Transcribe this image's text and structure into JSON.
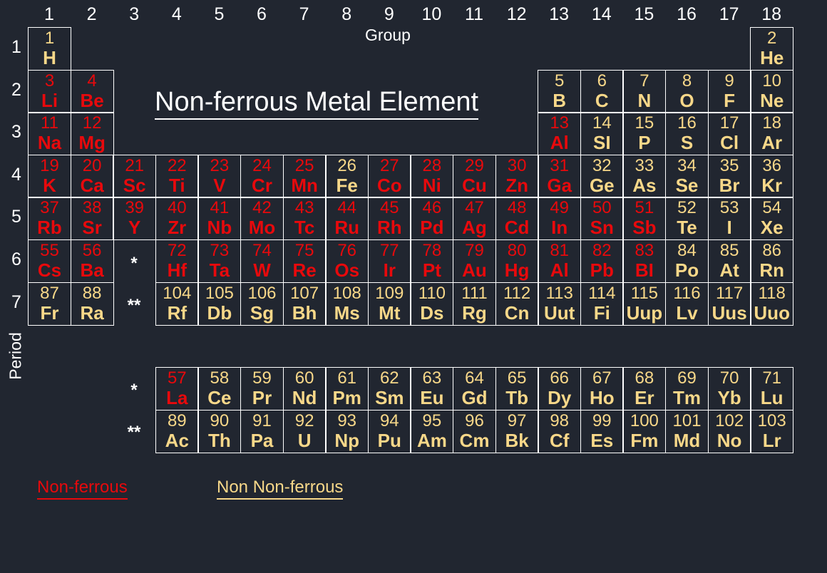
{
  "title": "Non-ferrous Metal Element",
  "axis": {
    "group_label": "Group",
    "period_label": "Period",
    "groups": [
      "1",
      "2",
      "3",
      "4",
      "5",
      "6",
      "7",
      "8",
      "9",
      "10",
      "11",
      "12",
      "13",
      "14",
      "15",
      "16",
      "17",
      "18"
    ],
    "periods": [
      "1",
      "2",
      "3",
      "4",
      "5",
      "6",
      "7"
    ]
  },
  "colors": {
    "background": "#212630",
    "non_ferrous": "#e8090c",
    "non_non_ferrous": "#f8d889",
    "grid_line": "#ffffff"
  },
  "legend": {
    "non_ferrous": "Non-ferrous",
    "non_non_ferrous": "Non Non-ferrous"
  },
  "placeholders": {
    "lanthanide_marker": "*",
    "actinide_marker": "**"
  },
  "elements": [
    {
      "n": "1",
      "s": "H",
      "g": 1,
      "p": 1,
      "nf": false
    },
    {
      "n": "2",
      "s": "He",
      "g": 18,
      "p": 1,
      "nf": false
    },
    {
      "n": "3",
      "s": "Li",
      "g": 1,
      "p": 2,
      "nf": true
    },
    {
      "n": "4",
      "s": "Be",
      "g": 2,
      "p": 2,
      "nf": true
    },
    {
      "n": "5",
      "s": "B",
      "g": 13,
      "p": 2,
      "nf": false
    },
    {
      "n": "6",
      "s": "C",
      "g": 14,
      "p": 2,
      "nf": false
    },
    {
      "n": "7",
      "s": "N",
      "g": 15,
      "p": 2,
      "nf": false
    },
    {
      "n": "8",
      "s": "O",
      "g": 16,
      "p": 2,
      "nf": false
    },
    {
      "n": "9",
      "s": "F",
      "g": 17,
      "p": 2,
      "nf": false
    },
    {
      "n": "10",
      "s": "Ne",
      "g": 18,
      "p": 2,
      "nf": false
    },
    {
      "n": "11",
      "s": "Na",
      "g": 1,
      "p": 3,
      "nf": true
    },
    {
      "n": "12",
      "s": "Mg",
      "g": 2,
      "p": 3,
      "nf": true
    },
    {
      "n": "13",
      "s": "Al",
      "g": 13,
      "p": 3,
      "nf": true
    },
    {
      "n": "14",
      "s": "SI",
      "g": 14,
      "p": 3,
      "nf": false
    },
    {
      "n": "15",
      "s": "P",
      "g": 15,
      "p": 3,
      "nf": false
    },
    {
      "n": "16",
      "s": "S",
      "g": 16,
      "p": 3,
      "nf": false
    },
    {
      "n": "17",
      "s": "Cl",
      "g": 17,
      "p": 3,
      "nf": false
    },
    {
      "n": "18",
      "s": "Ar",
      "g": 18,
      "p": 3,
      "nf": false
    },
    {
      "n": "19",
      "s": "K",
      "g": 1,
      "p": 4,
      "nf": true
    },
    {
      "n": "20",
      "s": "Ca",
      "g": 2,
      "p": 4,
      "nf": true
    },
    {
      "n": "21",
      "s": "Sc",
      "g": 3,
      "p": 4,
      "nf": true
    },
    {
      "n": "22",
      "s": "Ti",
      "g": 4,
      "p": 4,
      "nf": true
    },
    {
      "n": "23",
      "s": "V",
      "g": 5,
      "p": 4,
      "nf": true
    },
    {
      "n": "24",
      "s": "Cr",
      "g": 6,
      "p": 4,
      "nf": true
    },
    {
      "n": "25",
      "s": "Mn",
      "g": 7,
      "p": 4,
      "nf": true
    },
    {
      "n": "26",
      "s": "Fe",
      "g": 8,
      "p": 4,
      "nf": false
    },
    {
      "n": "27",
      "s": "Co",
      "g": 9,
      "p": 4,
      "nf": true
    },
    {
      "n": "28",
      "s": "Ni",
      "g": 10,
      "p": 4,
      "nf": true
    },
    {
      "n": "29",
      "s": "Cu",
      "g": 11,
      "p": 4,
      "nf": true
    },
    {
      "n": "30",
      "s": "Zn",
      "g": 12,
      "p": 4,
      "nf": true
    },
    {
      "n": "31",
      "s": "Ga",
      "g": 13,
      "p": 4,
      "nf": true
    },
    {
      "n": "32",
      "s": "Ge",
      "g": 14,
      "p": 4,
      "nf": false
    },
    {
      "n": "33",
      "s": "As",
      "g": 15,
      "p": 4,
      "nf": false
    },
    {
      "n": "34",
      "s": "Se",
      "g": 16,
      "p": 4,
      "nf": false
    },
    {
      "n": "35",
      "s": "Br",
      "g": 17,
      "p": 4,
      "nf": false
    },
    {
      "n": "36",
      "s": "Kr",
      "g": 18,
      "p": 4,
      "nf": false
    },
    {
      "n": "37",
      "s": "Rb",
      "g": 1,
      "p": 5,
      "nf": true
    },
    {
      "n": "38",
      "s": "Sr",
      "g": 2,
      "p": 5,
      "nf": true
    },
    {
      "n": "39",
      "s": "Y",
      "g": 3,
      "p": 5,
      "nf": true
    },
    {
      "n": "40",
      "s": "Zr",
      "g": 4,
      "p": 5,
      "nf": true
    },
    {
      "n": "41",
      "s": "Nb",
      "g": 5,
      "p": 5,
      "nf": true
    },
    {
      "n": "42",
      "s": "Mo",
      "g": 6,
      "p": 5,
      "nf": true
    },
    {
      "n": "43",
      "s": "Tc",
      "g": 7,
      "p": 5,
      "nf": true
    },
    {
      "n": "44",
      "s": "Ru",
      "g": 8,
      "p": 5,
      "nf": true
    },
    {
      "n": "45",
      "s": "Rh",
      "g": 9,
      "p": 5,
      "nf": true
    },
    {
      "n": "46",
      "s": "Pd",
      "g": 10,
      "p": 5,
      "nf": true
    },
    {
      "n": "47",
      "s": "Ag",
      "g": 11,
      "p": 5,
      "nf": true
    },
    {
      "n": "48",
      "s": "Cd",
      "g": 12,
      "p": 5,
      "nf": true
    },
    {
      "n": "49",
      "s": "In",
      "g": 13,
      "p": 5,
      "nf": true
    },
    {
      "n": "50",
      "s": "Sn",
      "g": 14,
      "p": 5,
      "nf": true
    },
    {
      "n": "51",
      "s": "Sb",
      "g": 15,
      "p": 5,
      "nf": true
    },
    {
      "n": "52",
      "s": "Te",
      "g": 16,
      "p": 5,
      "nf": false
    },
    {
      "n": "53",
      "s": "I",
      "g": 17,
      "p": 5,
      "nf": false
    },
    {
      "n": "54",
      "s": "Xe",
      "g": 18,
      "p": 5,
      "nf": false
    },
    {
      "n": "55",
      "s": "Cs",
      "g": 1,
      "p": 6,
      "nf": true
    },
    {
      "n": "56",
      "s": "Ba",
      "g": 2,
      "p": 6,
      "nf": true
    },
    {
      "n": "72",
      "s": "Hf",
      "g": 4,
      "p": 6,
      "nf": true
    },
    {
      "n": "73",
      "s": "Ta",
      "g": 5,
      "p": 6,
      "nf": true
    },
    {
      "n": "74",
      "s": "W",
      "g": 6,
      "p": 6,
      "nf": true
    },
    {
      "n": "75",
      "s": "Re",
      "g": 7,
      "p": 6,
      "nf": true
    },
    {
      "n": "76",
      "s": "Os",
      "g": 8,
      "p": 6,
      "nf": true
    },
    {
      "n": "77",
      "s": "Ir",
      "g": 9,
      "p": 6,
      "nf": true
    },
    {
      "n": "78",
      "s": "Pt",
      "g": 10,
      "p": 6,
      "nf": true
    },
    {
      "n": "79",
      "s": "Au",
      "g": 11,
      "p": 6,
      "nf": true
    },
    {
      "n": "80",
      "s": "Hg",
      "g": 12,
      "p": 6,
      "nf": true
    },
    {
      "n": "81",
      "s": "Al",
      "g": 13,
      "p": 6,
      "nf": true
    },
    {
      "n": "82",
      "s": "Pb",
      "g": 14,
      "p": 6,
      "nf": true
    },
    {
      "n": "83",
      "s": "BI",
      "g": 15,
      "p": 6,
      "nf": true
    },
    {
      "n": "84",
      "s": "Po",
      "g": 16,
      "p": 6,
      "nf": false
    },
    {
      "n": "85",
      "s": "At",
      "g": 17,
      "p": 6,
      "nf": false
    },
    {
      "n": "86",
      "s": "Rn",
      "g": 18,
      "p": 6,
      "nf": false
    },
    {
      "n": "87",
      "s": "Fr",
      "g": 1,
      "p": 7,
      "nf": false
    },
    {
      "n": "88",
      "s": "Ra",
      "g": 2,
      "p": 7,
      "nf": false
    },
    {
      "n": "104",
      "s": "Rf",
      "g": 4,
      "p": 7,
      "nf": false
    },
    {
      "n": "105",
      "s": "Db",
      "g": 5,
      "p": 7,
      "nf": false
    },
    {
      "n": "106",
      "s": "Sg",
      "g": 6,
      "p": 7,
      "nf": false
    },
    {
      "n": "107",
      "s": "Bh",
      "g": 7,
      "p": 7,
      "nf": false
    },
    {
      "n": "108",
      "s": "Ms",
      "g": 8,
      "p": 7,
      "nf": false
    },
    {
      "n": "109",
      "s": "Mt",
      "g": 9,
      "p": 7,
      "nf": false
    },
    {
      "n": "110",
      "s": "Ds",
      "g": 10,
      "p": 7,
      "nf": false
    },
    {
      "n": "111",
      "s": "Rg",
      "g": 11,
      "p": 7,
      "nf": false
    },
    {
      "n": "112",
      "s": "Cn",
      "g": 12,
      "p": 7,
      "nf": false
    },
    {
      "n": "113",
      "s": "Uut",
      "g": 13,
      "p": 7,
      "nf": false
    },
    {
      "n": "114",
      "s": "Fi",
      "g": 14,
      "p": 7,
      "nf": false
    },
    {
      "n": "115",
      "s": "Uup",
      "g": 15,
      "p": 7,
      "nf": false
    },
    {
      "n": "116",
      "s": "Lv",
      "g": 16,
      "p": 7,
      "nf": false
    },
    {
      "n": "117",
      "s": "Uus",
      "g": 17,
      "p": 7,
      "nf": false
    },
    {
      "n": "118",
      "s": "Uuo",
      "g": 18,
      "p": 7,
      "nf": false
    }
  ],
  "lanthanides": [
    {
      "n": "57",
      "s": "La",
      "nf": true
    },
    {
      "n": "58",
      "s": "Ce",
      "nf": false
    },
    {
      "n": "59",
      "s": "Pr",
      "nf": false
    },
    {
      "n": "60",
      "s": "Nd",
      "nf": false
    },
    {
      "n": "61",
      "s": "Pm",
      "nf": false
    },
    {
      "n": "62",
      "s": "Sm",
      "nf": false
    },
    {
      "n": "63",
      "s": "Eu",
      "nf": false
    },
    {
      "n": "64",
      "s": "Gd",
      "nf": false
    },
    {
      "n": "65",
      "s": "Tb",
      "nf": false
    },
    {
      "n": "66",
      "s": "Dy",
      "nf": false
    },
    {
      "n": "67",
      "s": "Ho",
      "nf": false
    },
    {
      "n": "68",
      "s": "Er",
      "nf": false
    },
    {
      "n": "69",
      "s": "Tm",
      "nf": false
    },
    {
      "n": "70",
      "s": "Yb",
      "nf": false
    },
    {
      "n": "71",
      "s": "Lu",
      "nf": false
    }
  ],
  "actinides": [
    {
      "n": "89",
      "s": "Ac",
      "nf": false
    },
    {
      "n": "90",
      "s": "Th",
      "nf": false
    },
    {
      "n": "91",
      "s": "Pa",
      "nf": false
    },
    {
      "n": "92",
      "s": "U",
      "nf": false
    },
    {
      "n": "93",
      "s": "Np",
      "nf": false
    },
    {
      "n": "94",
      "s": "Pu",
      "nf": false
    },
    {
      "n": "95",
      "s": "Am",
      "nf": false
    },
    {
      "n": "96",
      "s": "Cm",
      "nf": false
    },
    {
      "n": "97",
      "s": "Bk",
      "nf": false
    },
    {
      "n": "98",
      "s": "Cf",
      "nf": false
    },
    {
      "n": "99",
      "s": "Es",
      "nf": false
    },
    {
      "n": "100",
      "s": "Fm",
      "nf": false
    },
    {
      "n": "101",
      "s": "Md",
      "nf": false
    },
    {
      "n": "102",
      "s": "No",
      "nf": false
    },
    {
      "n": "103",
      "s": "Lr",
      "nf": false
    }
  ]
}
